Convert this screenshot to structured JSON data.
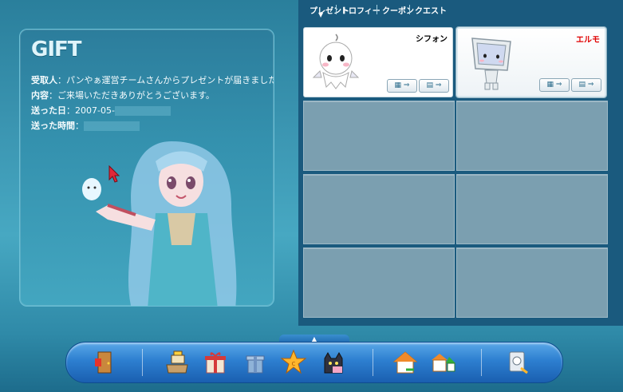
{
  "gift": {
    "title": "GIFT",
    "recipient_label": "受取人",
    "recipient_value": "：パンやぁ運営チームさんからプレゼントが届きました。",
    "content_label": "内容",
    "content_value": "：ご来場いただきありがとうございます。",
    "sent_date_label": "送った日",
    "sent_date_value": "：2007-05-",
    "sent_time_label": "送った時間",
    "sent_time_value": "："
  },
  "tabs": [
    {
      "label": "プレゼント",
      "active": true
    },
    {
      "label": "トロフィー"
    },
    {
      "label": "クーポン"
    },
    {
      "label": "クエスト"
    }
  ],
  "cards": [
    {
      "name": "シフォン",
      "name_color": "#000000",
      "icon": "chiffon-ghost-icon",
      "btn_move": "⇒",
      "btn_use": "⇒"
    },
    {
      "name": "エルモ",
      "name_color": "#e00000",
      "icon": "elmo-monitor-icon",
      "btn_move": "⇒",
      "btn_use": "⇒"
    }
  ],
  "toolbar": {
    "expand_label": "▲",
    "icons": [
      "exit-door-icon",
      "cash-register-icon",
      "gift-box-icon",
      "present-box-icon",
      "star-badge-icon",
      "cat-pet-icon",
      "home-icon",
      "house-exchange-icon",
      "settings-plug-icon"
    ]
  }
}
